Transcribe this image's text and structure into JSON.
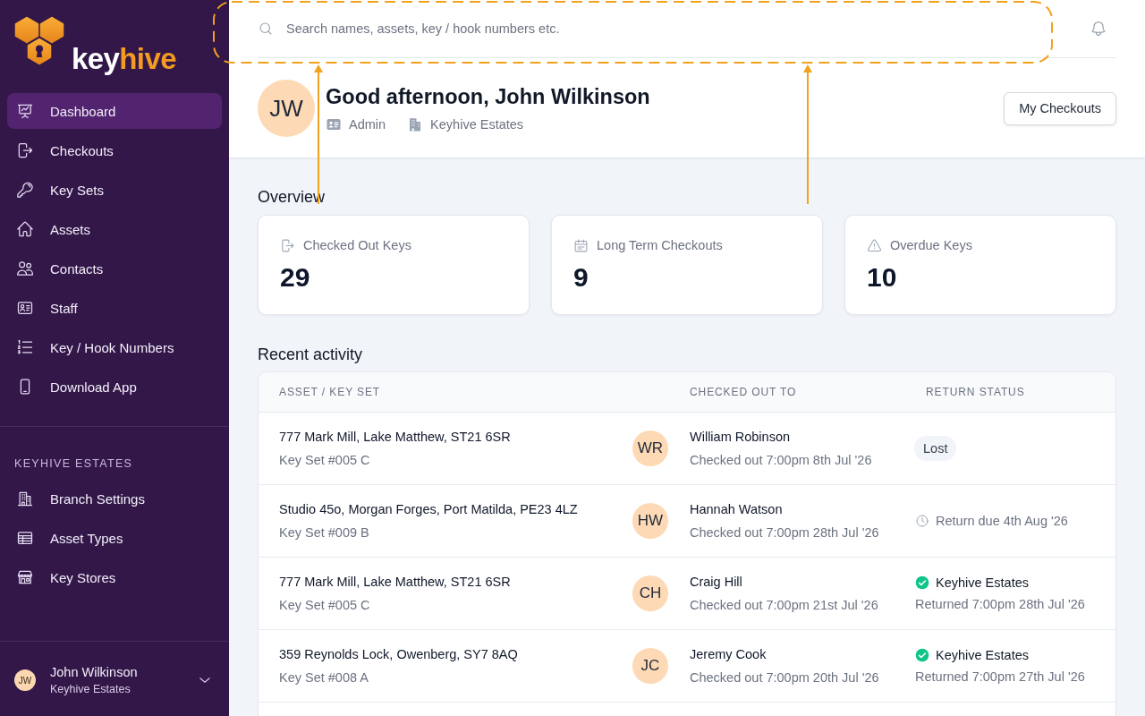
{
  "sidebar": {
    "logo": {
      "part_1": "key",
      "part_2": "hive"
    },
    "nav": [
      {
        "label": "Dashboard",
        "selected": true
      },
      {
        "label": "Checkouts",
        "selected": false
      },
      {
        "label": "Key Sets",
        "selected": false
      },
      {
        "label": "Assets",
        "selected": false
      },
      {
        "label": "Contacts",
        "selected": false
      },
      {
        "label": "Staff",
        "selected": false
      },
      {
        "label": "Key / Hook Numbers",
        "selected": false
      },
      {
        "label": "Download App",
        "selected": false
      }
    ],
    "section": {
      "title": "KEYHIVE ESTATES",
      "items": [
        {
          "label": "Branch Settings",
          "selected": false
        },
        {
          "label": "Asset Types",
          "selected": false
        },
        {
          "label": "Key Stores",
          "selected": false
        }
      ]
    },
    "user": {
      "initials": "JW",
      "name": "John Wilkinson",
      "organisation": "Keyhive Estates"
    }
  },
  "header": {
    "search": {
      "placeholder": "Search names, assets, key / hook numbers etc."
    }
  },
  "profile": {
    "initials": "JW",
    "greeting": "Good afternoon, John Wilkinson",
    "role": "Admin",
    "branch": "Keyhive Estates",
    "button": "My Checkouts"
  },
  "overview": {
    "title": "Overview",
    "cards": [
      {
        "label": "Checked Out Keys",
        "value": "29"
      },
      {
        "label": "Long Term Checkouts",
        "value": "9"
      },
      {
        "label": "Overdue Keys",
        "value": "10"
      }
    ]
  },
  "recent_activity": {
    "title": "Recent activity",
    "columns": [
      "ASSET / KEY SET",
      "CHECKED OUT TO",
      "RETURN STATUS"
    ],
    "rows": [
      {
        "asset": "777 Mark Mill, Lake Matthew, ST21 6SR",
        "key_set": "Key Set #005 C",
        "initials": "WR",
        "person": "William Robinson",
        "checked_out": "Checked out 7:00pm 8th Jul '26",
        "status": {
          "kind": "lost",
          "label": "Lost"
        }
      },
      {
        "asset": "Studio 45o, Morgan Forges, Port Matilda, PE23 4LZ",
        "key_set": "Key Set #009 B",
        "initials": "HW",
        "person": "Hannah Watson",
        "checked_out": "Checked out 7:00pm 28th Jul '26",
        "status": {
          "kind": "due",
          "label": "Return due 4th Aug '26"
        }
      },
      {
        "asset": "777 Mark Mill, Lake Matthew, ST21 6SR",
        "key_set": "Key Set #005 C",
        "initials": "CH",
        "person": "Craig Hill",
        "checked_out": "Checked out 7:00pm 21st Jul '26",
        "status": {
          "kind": "returned",
          "label": "Keyhive Estates",
          "detail": "Returned 7:00pm 28th Jul '26"
        }
      },
      {
        "asset": "359 Reynolds Lock, Owenberg, SY7 8AQ",
        "key_set": "Key Set #008 A",
        "initials": "JC",
        "person": "Jeremy Cook",
        "checked_out": "Checked out 7:00pm 20th Jul '26",
        "status": {
          "kind": "returned",
          "label": "Keyhive Estates",
          "detail": "Returned 7:00pm 27th Jul '26"
        }
      }
    ]
  }
}
